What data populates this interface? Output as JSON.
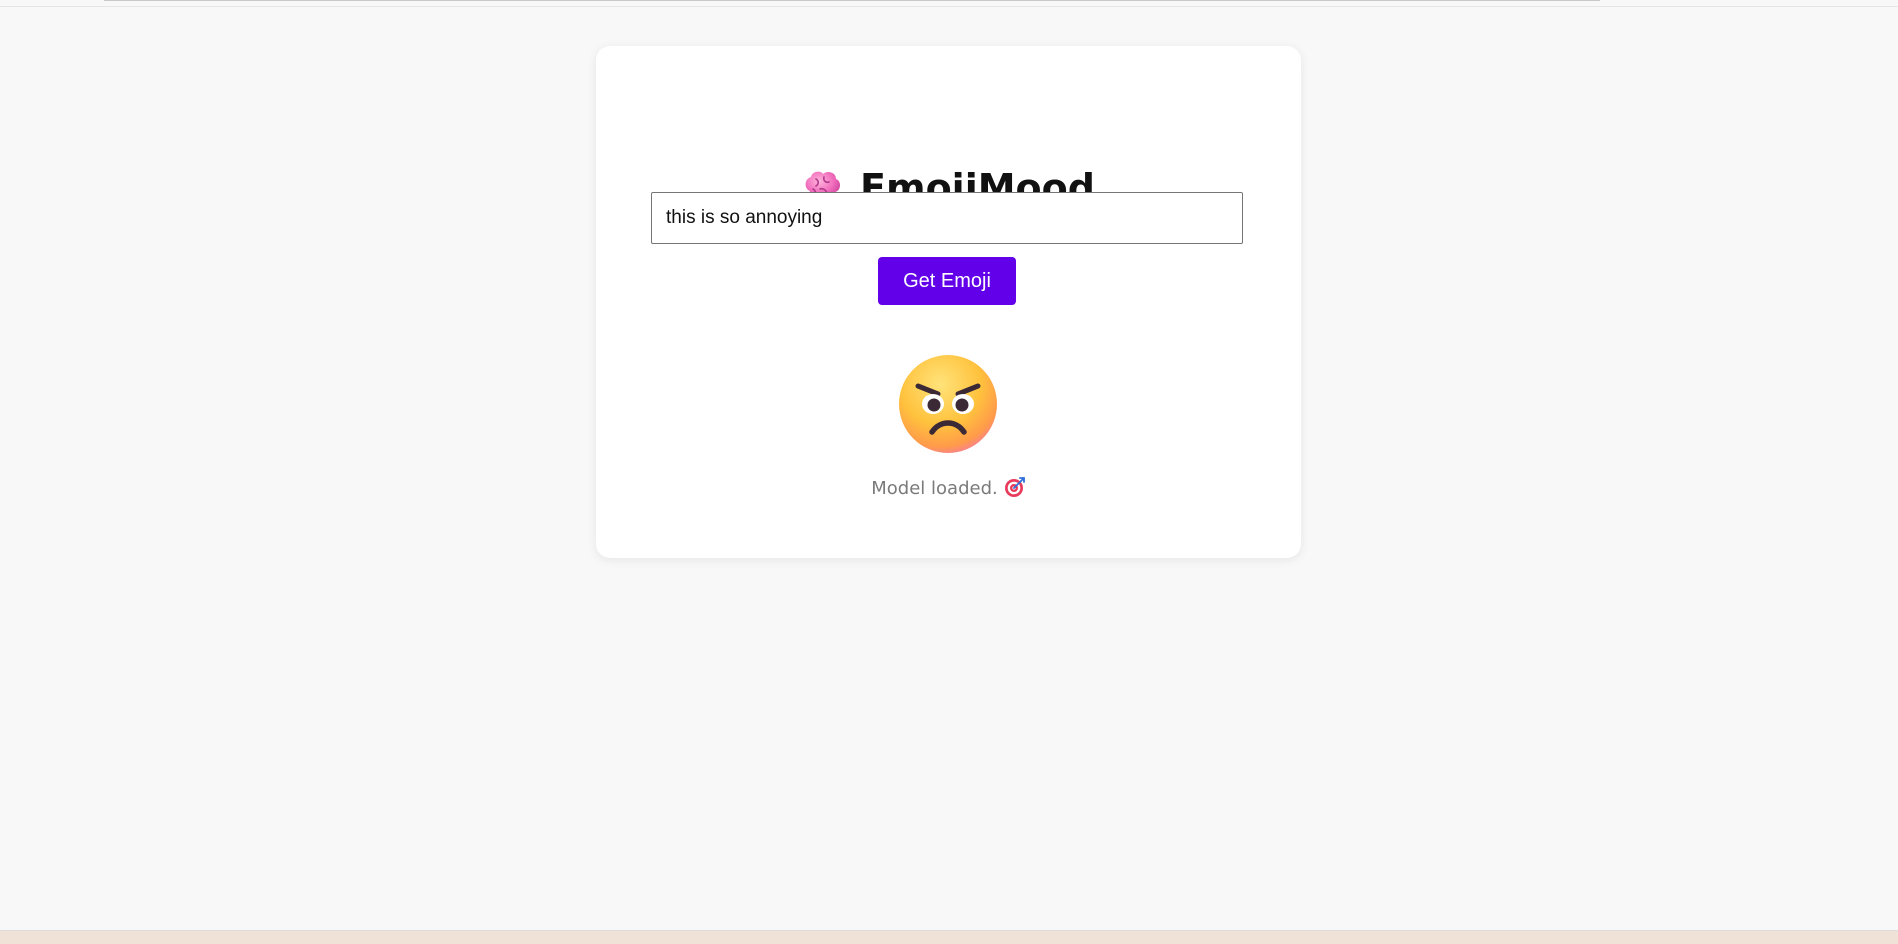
{
  "app": {
    "title": "EmojiMood",
    "title_icon": "brain-icon"
  },
  "form": {
    "input_value": "this is so annoying",
    "button_label": "Get Emoji"
  },
  "result": {
    "emoji_icon": "angry-face-icon",
    "status_text": "Model loaded.",
    "status_icon": "target-icon"
  },
  "colors": {
    "accent": "#6200ea",
    "background": "#f8f8f8",
    "card": "#ffffff",
    "status_text": "#7a7a7a"
  }
}
